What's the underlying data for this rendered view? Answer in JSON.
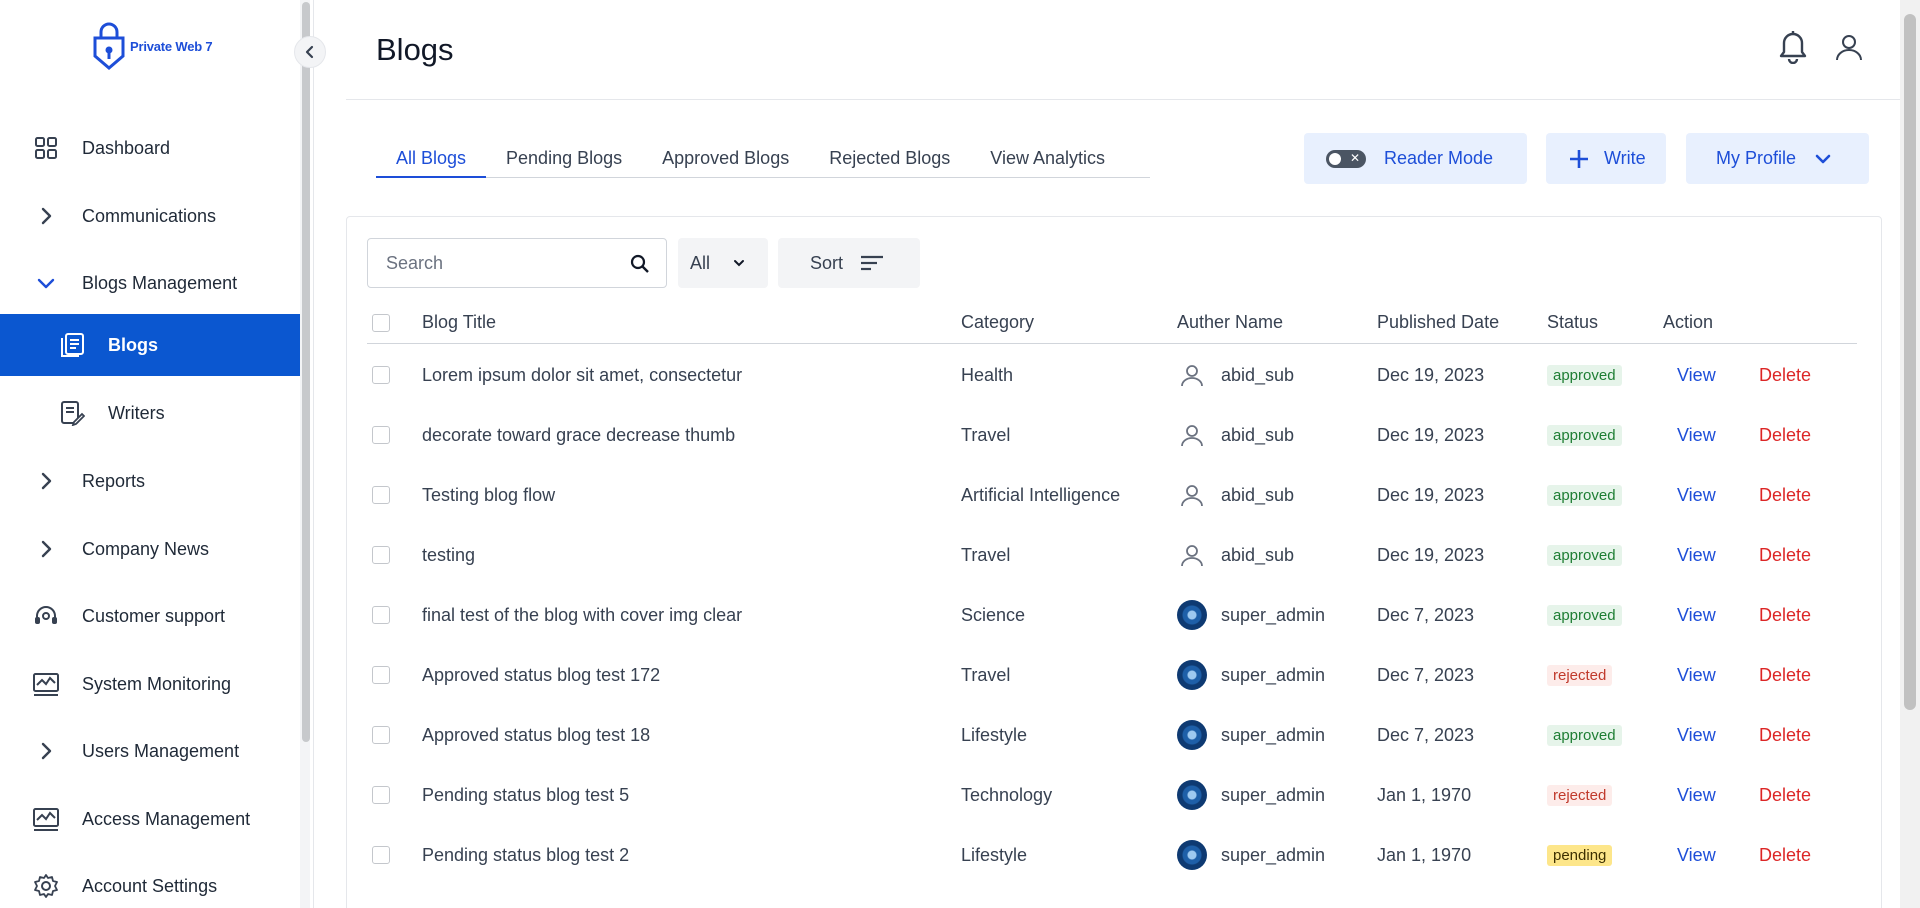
{
  "brand": {
    "name": "Private Web 7",
    "color": "#1d4ed8"
  },
  "sidebar": {
    "items": [
      {
        "label": "Dashboard",
        "icon": "grid-icon"
      },
      {
        "label": "Communications",
        "icon": "chevron-right-icon"
      },
      {
        "label": "Blogs Management",
        "icon": "chevron-down-icon"
      },
      {
        "label": "Blogs",
        "icon": "blog-list-icon",
        "active": true
      },
      {
        "label": "Writers",
        "icon": "writer-icon"
      },
      {
        "label": "Reports",
        "icon": "chevron-right-icon"
      },
      {
        "label": "Company News",
        "icon": "chevron-right-icon"
      },
      {
        "label": "Customer support",
        "icon": "headset-icon"
      },
      {
        "label": "System Monitoring",
        "icon": "monitor-chart-icon"
      },
      {
        "label": "Users Management",
        "icon": "chevron-right-icon"
      },
      {
        "label": "Access Management",
        "icon": "monitor-chart-icon"
      },
      {
        "label": "Account Settings",
        "icon": "gear-icon"
      }
    ]
  },
  "header": {
    "title": "Blogs"
  },
  "tabs": [
    "All Blogs",
    "Pending Blogs",
    "Approved Blogs",
    "Rejected Blogs",
    "View Analytics"
  ],
  "toolbar": {
    "reader_mode": "Reader Mode",
    "write": "Write",
    "profile": "My Profile"
  },
  "search": {
    "placeholder": "Search"
  },
  "filter": {
    "selected": "All"
  },
  "sort": {
    "label": "Sort"
  },
  "table": {
    "headers": [
      "Blog Title",
      "Category",
      "Auther Name",
      "Published Date",
      "Status",
      "Action"
    ],
    "action_view": "View",
    "action_delete": "Delete",
    "rows": [
      {
        "title": "Lorem ipsum dolor sit amet, consectetur",
        "category": "Health",
        "author": "abid_sub",
        "avatar": "user-outline",
        "date": "Dec 19, 2023",
        "status": "approved"
      },
      {
        "title": "decorate toward grace decrease thumb",
        "category": "Travel",
        "author": "abid_sub",
        "avatar": "user-outline",
        "date": "Dec 19, 2023",
        "status": "approved"
      },
      {
        "title": "Testing blog flow",
        "category": "Artificial Intelligence",
        "author": "abid_sub",
        "avatar": "user-outline",
        "date": "Dec 19, 2023",
        "status": "approved"
      },
      {
        "title": "testing",
        "category": "Travel",
        "author": "abid_sub",
        "avatar": "user-outline",
        "date": "Dec 19, 2023",
        "status": "approved"
      },
      {
        "title": "final test of the blog with cover img clear",
        "category": "Science",
        "author": "super_admin",
        "avatar": "photo",
        "date": "Dec 7, 2023",
        "status": "approved"
      },
      {
        "title": "Approved status blog test 172",
        "category": "Travel",
        "author": "super_admin",
        "avatar": "photo",
        "date": "Dec 7, 2023",
        "status": "rejected"
      },
      {
        "title": "Approved status blog test 18",
        "category": "Lifestyle",
        "author": "super_admin",
        "avatar": "photo",
        "date": "Dec 7, 2023",
        "status": "approved"
      },
      {
        "title": "Pending status blog test 5",
        "category": "Technology",
        "author": "super_admin",
        "avatar": "photo",
        "date": "Jan 1, 1970",
        "status": "rejected"
      },
      {
        "title": "Pending status blog test 2",
        "category": "Lifestyle",
        "author": "super_admin",
        "avatar": "photo",
        "date": "Jan 1, 1970",
        "status": "pending"
      }
    ]
  }
}
